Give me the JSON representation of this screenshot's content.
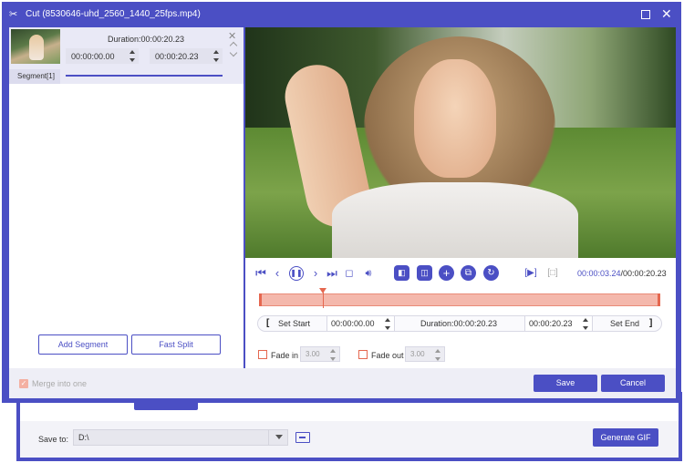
{
  "background_window": {
    "save_to_label": "Save to:",
    "save_to_value": "D:\\",
    "generate_gif_label": "Generate GIF"
  },
  "window": {
    "title": "Cut (8530646-uhd_2560_1440_25fps.mp4)",
    "app_icon": "scissors-icon"
  },
  "segment": {
    "duration": "Duration:00:00:20.23",
    "start_time": "00:00:00.00",
    "end_time": "00:00:20.23",
    "label": "Segment[1]"
  },
  "left_buttons": {
    "add_segment": "Add Segment",
    "fast_split": "Fast Split"
  },
  "player": {
    "current_time": "00:00:03.24",
    "total_time": "/00:00:20.23",
    "progress_fraction": 0.16
  },
  "set_row": {
    "set_start": "Set Start",
    "start_value": "00:00:00.00",
    "duration": "Duration:00:00:20.23",
    "end_value": "00:00:20.23",
    "set_end": "Set End"
  },
  "fade": {
    "fade_in_label": "Fade in",
    "fade_in_value": "3.00",
    "fade_out_label": "Fade out",
    "fade_out_value": "3.00"
  },
  "bottom": {
    "merge_label": "Merge into one",
    "save": "Save",
    "cancel": "Cancel"
  },
  "colors": {
    "accent": "#4b4fc4",
    "timeline": "#f4b8ac",
    "playhead": "#e5674f"
  }
}
